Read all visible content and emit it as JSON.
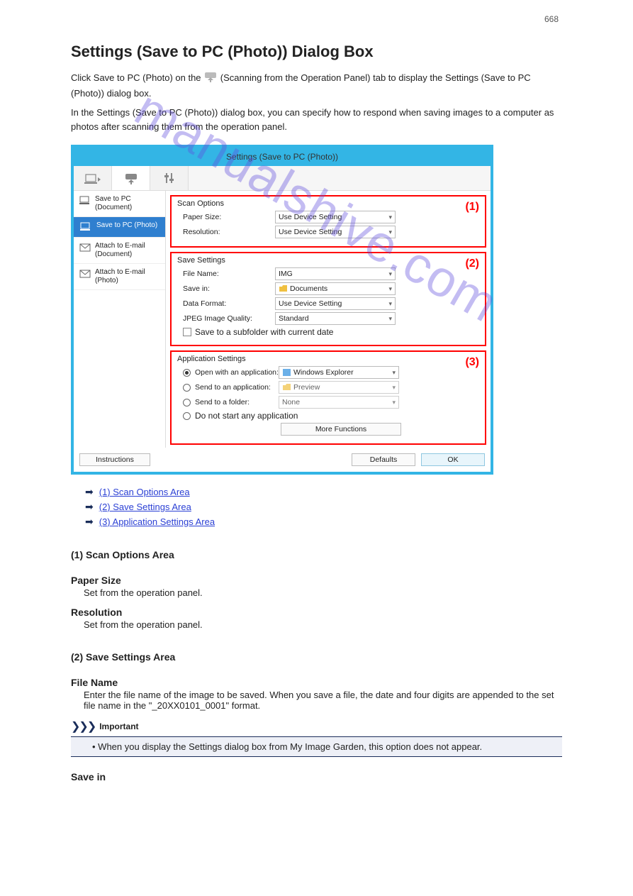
{
  "page": {
    "number": "668",
    "title": "Settings (Save to PC (Photo)) Dialog Box",
    "intro_a": "Click Save to PC (Photo) on the ",
    "intro_b": " (Scanning from the Operation Panel) tab to display the Settings (Save to PC (Photo)) dialog box.",
    "intro_c": "In the Settings (Save to PC (Photo)) dialog box, you can specify how to respond when saving images to a computer as photos after scanning them from the operation panel.",
    "watermark": "manualshive.com"
  },
  "dialog": {
    "title": "Settings (Save to PC (Photo))",
    "sidebar": [
      "Save to PC (Document)",
      "Save to PC (Photo)",
      "Attach to E-mail (Document)",
      "Attach to E-mail (Photo)"
    ],
    "badges": [
      "(1)",
      "(2)",
      "(3)"
    ],
    "sections": [
      {
        "title": "Scan Options",
        "rows": [
          {
            "label": "Paper Size:",
            "value": "Use Device Setting"
          },
          {
            "label": "Resolution:",
            "value": "Use Device Setting"
          }
        ]
      },
      {
        "title": "Save Settings",
        "rows": [
          {
            "label": "File Name:",
            "value": "IMG"
          },
          {
            "label": "Save in:",
            "value": "Documents"
          },
          {
            "label": "Data Format:",
            "value": "Use Device Setting"
          },
          {
            "label": "JPEG Image Quality:",
            "value": "Standard"
          }
        ],
        "checkbox": "Save to a subfolder with current date"
      },
      {
        "title": "Application Settings",
        "rows": [
          {
            "label": "Open with an application:",
            "value": "Windows Explorer"
          },
          {
            "label": "Send to an application:",
            "value": "Preview"
          },
          {
            "label": "Send to a folder:",
            "value": "None"
          },
          {
            "label": "Do not start any application"
          }
        ],
        "more_button": "More Functions"
      }
    ],
    "footer": {
      "instructions": "Instructions",
      "defaults": "Defaults",
      "ok": "OK"
    }
  },
  "links": [
    "(1) Scan Options Area",
    "(2) Save Settings Area",
    "(3) Application Settings Area"
  ],
  "body": {
    "section1_heading": "(1) Scan Options Area",
    "section2_heading": "(2) Save Settings Area",
    "fields": [
      {
        "name": "Paper Size",
        "desc": "Set from the operation panel."
      },
      {
        "name": "Resolution",
        "desc": "Set from the operation panel."
      },
      {
        "name": "File Name",
        "desc": "Enter the file name of the image to be saved. When you save a file, the date and four digits are appended to the set file name in the \"_20XX0101_0001\" format."
      },
      {
        "name": "Save in"
      }
    ],
    "important": {
      "title": "Important",
      "text": "When you display the Settings dialog box from My Image Garden, this option does not appear."
    }
  }
}
